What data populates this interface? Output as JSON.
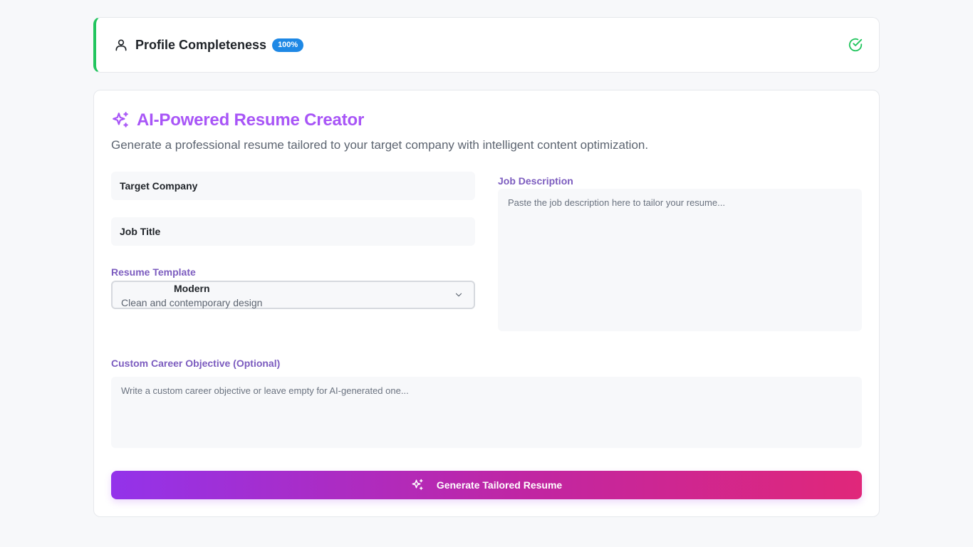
{
  "profile": {
    "title": "Profile Completeness",
    "badge": "100%",
    "accent_color": "#22c55e",
    "badge_color": "#1e88e5",
    "icons": {
      "left": "user-icon",
      "right": "check-circle-icon"
    }
  },
  "creator": {
    "title": "AI-Powered Resume Creator",
    "subtitle": "Generate a professional resume tailored to your target company with intelligent content optimization.",
    "title_color": "#a855f7",
    "icon": "sparkles-icon"
  },
  "form": {
    "target_company": {
      "placeholder": "Target Company"
    },
    "job_title": {
      "placeholder": "Job Title"
    },
    "resume_template": {
      "label": "Resume Template",
      "selected": "Modern",
      "description": "Clean and contemporary design"
    },
    "job_description": {
      "label": "Job Description",
      "placeholder": "Paste the job description here to tailor your resume..."
    },
    "career_objective": {
      "label": "Custom Career Objective (Optional)",
      "placeholder": "Write a custom career objective or leave empty for AI-generated one..."
    },
    "label_color": "#7c5cbf"
  },
  "generate_button": {
    "label": "Generate Tailored Resume",
    "gradient_start": "#9333ea",
    "gradient_end": "#e0277a",
    "icon": "sparkles-icon"
  }
}
